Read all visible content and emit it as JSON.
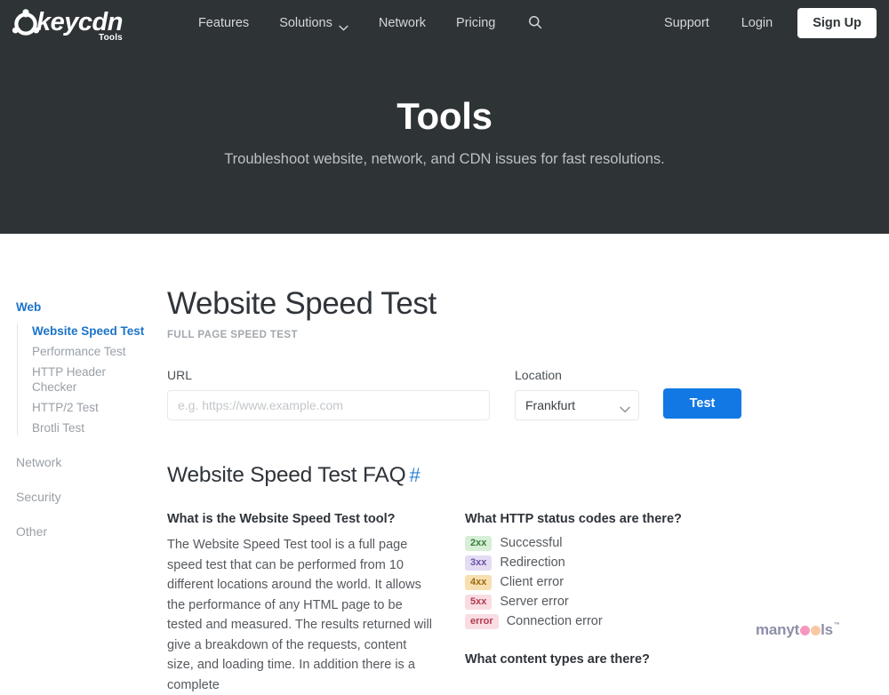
{
  "brand": {
    "logo_word": "keycdn",
    "logo_sub": "Tools",
    "logo_icon": "keycdn-key-circle-icon"
  },
  "nav": {
    "links": [
      {
        "label": "Features",
        "icon": null
      },
      {
        "label": "Solutions",
        "icon": "chevron-down-icon"
      },
      {
        "label": "Network",
        "icon": null
      },
      {
        "label": "Pricing",
        "icon": null
      }
    ],
    "search_icon": "search-icon",
    "right": [
      {
        "label": "Support"
      },
      {
        "label": "Login"
      }
    ],
    "signup_label": "Sign Up"
  },
  "hero": {
    "title": "Tools",
    "subtitle": "Troubleshoot website, network, and CDN issues for fast resolutions."
  },
  "sidebar": {
    "groups": [
      {
        "label": "Web",
        "active": true,
        "items": [
          {
            "label": "Website Speed Test",
            "active": true
          },
          {
            "label": "Performance Test",
            "active": false
          },
          {
            "label": "HTTP Header Checker",
            "active": false
          },
          {
            "label": "HTTP/2 Test",
            "active": false
          },
          {
            "label": "Brotli Test",
            "active": false
          }
        ]
      },
      {
        "label": "Network",
        "active": false,
        "items": []
      },
      {
        "label": "Security",
        "active": false,
        "items": []
      },
      {
        "label": "Other",
        "active": false,
        "items": []
      }
    ]
  },
  "page": {
    "title": "Website Speed Test",
    "kicker": "FULL PAGE SPEED TEST"
  },
  "form": {
    "url_label": "URL",
    "url_value": "",
    "url_placeholder": "e.g. https://www.example.com",
    "location_label": "Location",
    "location_value": "Frankfurt",
    "location_options": [
      "Frankfurt"
    ],
    "submit_label": "Test"
  },
  "faq": {
    "heading": "Website Speed Test FAQ",
    "anchor": "#",
    "left": {
      "question": "What is the Website Speed Test tool?",
      "answer": "The Website Speed Test tool is a full page speed test that can be performed from 10 different locations around the world. It allows the performance of any HTML page to be tested and measured. The results returned will give a breakdown of the requests, content size, and loading time. In addition there is a complete"
    },
    "right": {
      "question": "What HTTP status codes are there?",
      "status_codes": [
        {
          "code": "2xx",
          "label": "Successful",
          "bg": "#d6efd6",
          "fg": "#3d7d3d"
        },
        {
          "code": "3xx",
          "label": "Redirection",
          "bg": "#e4dcf3",
          "fg": "#6b52a8"
        },
        {
          "code": "4xx",
          "label": "Client error",
          "bg": "#f8dfb0",
          "fg": "#9a6a13"
        },
        {
          "code": "5xx",
          "label": "Server error",
          "bg": "#f9dde3",
          "fg": "#b23a50"
        },
        {
          "code": "error",
          "label": "Connection error",
          "bg": "#f9dde3",
          "fg": "#b23a50"
        }
      ],
      "question2": "What content types are there?"
    }
  },
  "watermark": {
    "part1": "manyt",
    "part2": "ls",
    "tm": "™",
    "dot1_color": "#f598bf",
    "dot2_color": "#f7c9a3",
    "text_color": "#8d8fa8"
  },
  "colors": {
    "header_bg": "#2e3336",
    "accent_blue": "#1278e4",
    "link_blue": "#1a73c8"
  }
}
